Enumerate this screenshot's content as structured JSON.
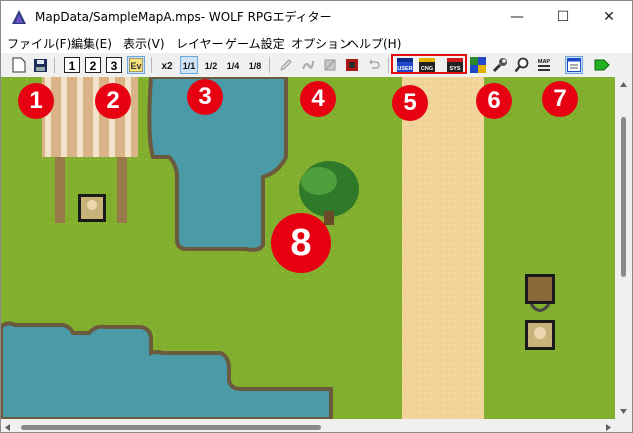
{
  "window": {
    "title": "MapData/SampleMapA.mps- WOLF RPGエディター",
    "minimize": "—",
    "maximize": "☐",
    "close": "✕"
  },
  "menu": [
    "ファイル(F)",
    "編集(E)",
    "表示(V)",
    "レイヤー",
    "ゲーム設定",
    "オプション",
    "ヘルプ(H)"
  ],
  "toolbar": {
    "layer1": "1",
    "layer2": "2",
    "layer3": "3",
    "event_mode": "Ev",
    "zoom_x2": "x2",
    "zoom_1_1": "1/1",
    "zoom_1_2": "1/2",
    "zoom_1_4": "1/4",
    "zoom_1_8": "1/8",
    "db_user": "USER",
    "db_cng": "CNG",
    "db_sys": "SYS",
    "map_label": "MAP"
  },
  "badges": [
    "1",
    "2",
    "3",
    "4",
    "5",
    "6",
    "7",
    "8"
  ],
  "colors": {
    "grass": "#82b02e",
    "water": "#4a9aa8",
    "path": "#f0d49a",
    "badge": "#e60012",
    "highlight_box": "#e01010",
    "selected_tool": "#cfe3f7"
  }
}
